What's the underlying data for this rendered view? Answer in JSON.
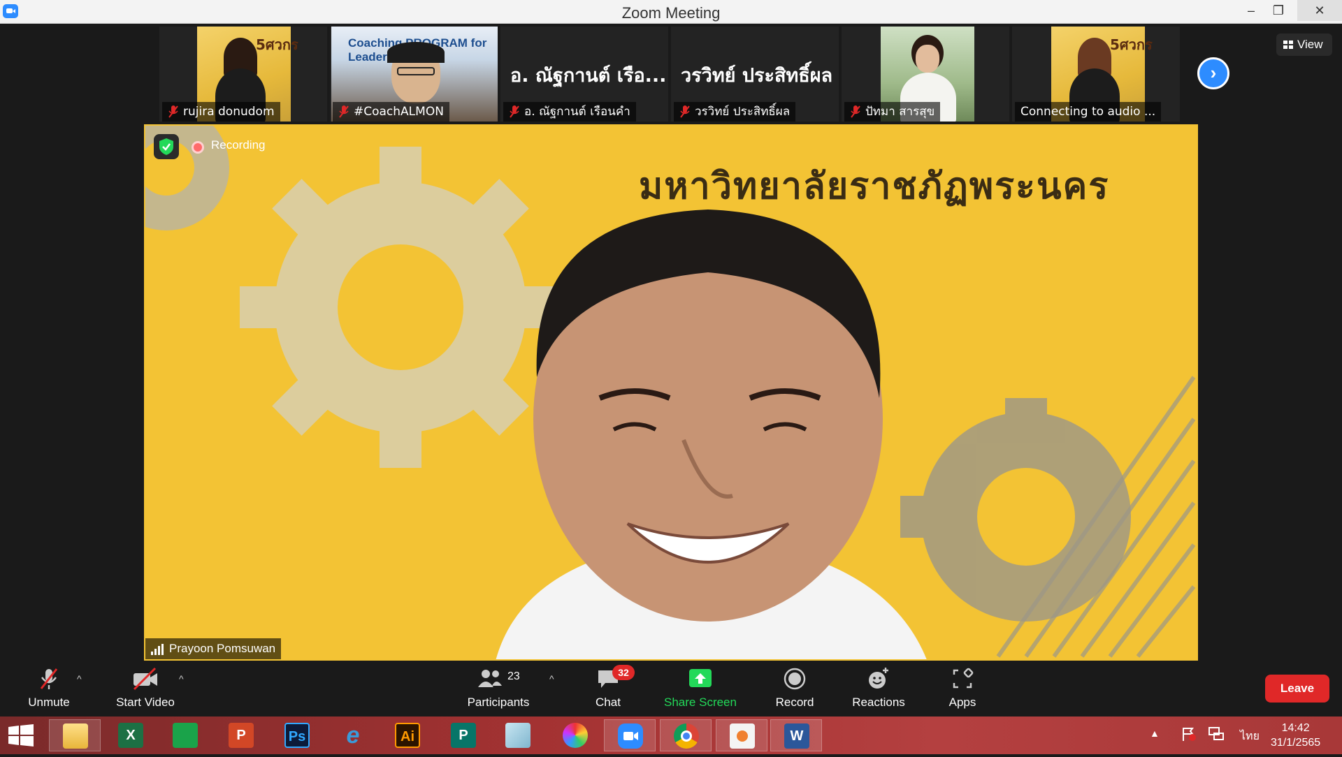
{
  "window": {
    "title": "Zoom Meeting",
    "controls": {
      "minimize": "–",
      "restore": "❐",
      "close": "✕"
    }
  },
  "gallery": {
    "tiles": [
      {
        "name": "rujira donudom",
        "muted": true,
        "type": "video"
      },
      {
        "name": "#CoachALMON",
        "muted": true,
        "type": "video",
        "poster_text": "Coaching PROGRAM for Leader"
      },
      {
        "name": "อ. ณัฐกานต์  เรือนคำ",
        "display_text": "อ. ณัฐกานต์  เรือ...",
        "muted": true,
        "type": "name-only"
      },
      {
        "name": "วรวิทย์ ประสิทธิ์ผล",
        "display_text": "วรวิทย์ ประสิทธิ์ผล",
        "muted": true,
        "type": "name-only"
      },
      {
        "name": "ปัทมา สารสุข",
        "muted": true,
        "type": "video"
      },
      {
        "name": "Connecting to audio",
        "suffix": "...",
        "muted": false,
        "type": "video"
      }
    ],
    "next_icon": "›",
    "view_label": "View"
  },
  "main": {
    "recording_label": "Recording",
    "banner_text": "มหาวิทยาลัยราชภัฏพระนคร",
    "speaker_name": "Prayoon Pomsuwan"
  },
  "toolbar": {
    "unmute_label": "Unmute",
    "start_video_label": "Start Video",
    "participants_label": "Participants",
    "participants_count": "23",
    "chat_label": "Chat",
    "chat_badge": "32",
    "share_label": "Share Screen",
    "record_label": "Record",
    "reactions_label": "Reactions",
    "apps_label": "Apps",
    "leave_label": "Leave",
    "caret": "^"
  },
  "taskbar": {
    "apps": [
      {
        "name": "File Explorer",
        "glyph": ""
      },
      {
        "name": "Excel",
        "glyph": "X"
      },
      {
        "name": "Store",
        "glyph": ""
      },
      {
        "name": "PowerPoint",
        "glyph": "P"
      },
      {
        "name": "Photoshop",
        "glyph": "Ps"
      },
      {
        "name": "Internet Explorer",
        "glyph": "e"
      },
      {
        "name": "Illustrator",
        "glyph": "Ai"
      },
      {
        "name": "Publisher",
        "glyph": "P"
      },
      {
        "name": "Notes",
        "glyph": ""
      },
      {
        "name": "PhotoScape",
        "glyph": ""
      },
      {
        "name": "Zoom",
        "glyph": ""
      },
      {
        "name": "Chrome",
        "glyph": ""
      },
      {
        "name": "Paint",
        "glyph": ""
      },
      {
        "name": "Word",
        "glyph": "W"
      }
    ],
    "language": "ไทย",
    "time": "14:42",
    "date": "31/1/2565"
  },
  "colors": {
    "zoom_blue": "#2d8cff",
    "leave_red": "#e02828",
    "share_green": "#23d959",
    "stage_yellow": "#f3c334"
  }
}
